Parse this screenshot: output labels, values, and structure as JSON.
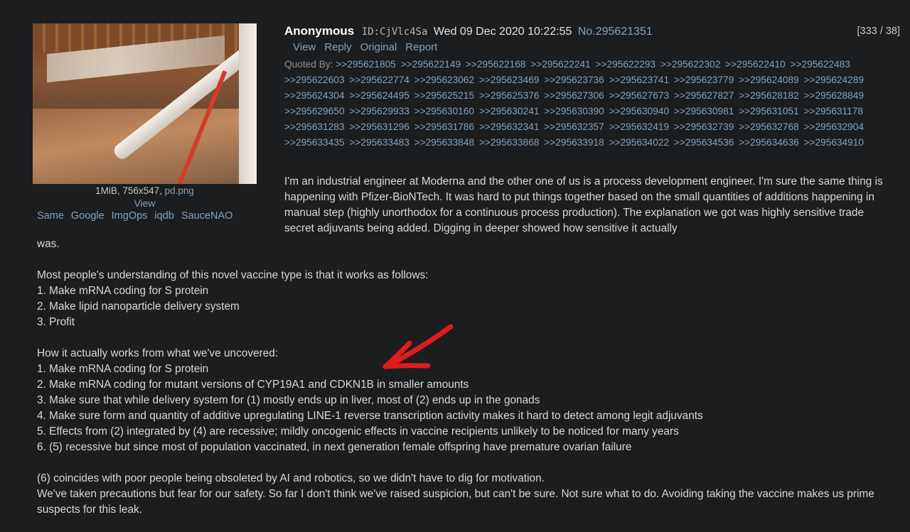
{
  "header": {
    "name": "Anonymous",
    "id": "ID:CjVlc4Sa",
    "date": "Wed 09 Dec 2020 10:22:55",
    "post_no": "No.295621351",
    "count": "[333 / 38]"
  },
  "actions": [
    "View",
    "Reply",
    "Original",
    "Report"
  ],
  "file": {
    "meta": "1MiB, 756x547,",
    "filename": "pd.png",
    "view": "View",
    "search_links": [
      "Same",
      "Google",
      "ImgOps",
      "iqdb",
      "SauceNAO"
    ]
  },
  "quoted_by": {
    "label": "Quoted By:",
    "links": [
      ">>295621805",
      ">>295622149",
      ">>295622168",
      ">>295622241",
      ">>295622293",
      ">>295622302",
      ">>295622410",
      ">>295622483",
      ">>295622603",
      ">>295622774",
      ">>295623062",
      ">>295623469",
      ">>295623736",
      ">>295623741",
      ">>295623779",
      ">>295624089",
      ">>295624289",
      ">>295624304",
      ">>295624495",
      ">>295625215",
      ">>295625376",
      ">>295627306",
      ">>295627673",
      ">>295627827",
      ">>295628182",
      ">>295628849",
      ">>295629650",
      ">>295629933",
      ">>295630160",
      ">>295630241",
      ">>295630390",
      ">>295630940",
      ">>295630981",
      ">>295631051",
      ">>295631178",
      ">>295631283",
      ">>295631296",
      ">>295631786",
      ">>295632341",
      ">>295632357",
      ">>295632419",
      ">>295632739",
      ">>295632768",
      ">>295632904",
      ">>295633435",
      ">>295633483",
      ">>295633848",
      ">>295633868",
      ">>295633918",
      ">>295634022",
      ">>295634536",
      ">>295634636",
      ">>295634910"
    ]
  },
  "body": {
    "intro": "I'm an industrial engineer at Moderna and the other one of us is a process development engineer. I'm sure the same thing is happening with Pfizer-BioNTech. It was hard to put things together based on the small quantities of additions happening in manual step (highly unorthodox for a continuous process production). The explanation we got was highly sensitive trade secret adjuvants being added. Digging in deeper showed how sensitive it actually",
    "intro_cont": "was.",
    "lines": [
      "",
      "Most people's understanding of this novel vaccine type is that it works as follows:",
      "1. Make mRNA coding for S protein",
      "2. Make lipid nanoparticle delivery system",
      "3. Profit",
      "",
      "How it actually works from what we've uncovered:",
      "1. Make mRNA coding for S protein",
      "2. Make mRNA coding for mutant versions of CYP19A1 and CDKN1B in smaller amounts",
      "3. Make sure that while delivery system for (1) mostly ends up in liver, most of (2) ends up in the gonads",
      "4. Make sure form and quantity of additive upregulating LINE-1 reverse transcription activity makes it hard to detect among legit adjuvants",
      "5. Effects from (2) integrated by (4) are recessive; mildly oncogenic effects in vaccine recipients unlikely to be noticed for many years",
      "6. (5) recessive but since most of population vaccinated, in next generation female offspring have premature ovarian failure",
      "",
      "(6) coincides with poor people being obsoleted by AI and robotics, so we didn't have to dig for motivation.",
      "We've taken precautions but fear for our safety. So far I don't think we've raised suspicion, but can't be sure. Not sure what to do. Avoiding taking the vaccine makes us prime suspects for this leak."
    ]
  },
  "colors": {
    "background": "#1c1d1f",
    "link": "#81a2be",
    "arrow": "#e01b1b"
  }
}
